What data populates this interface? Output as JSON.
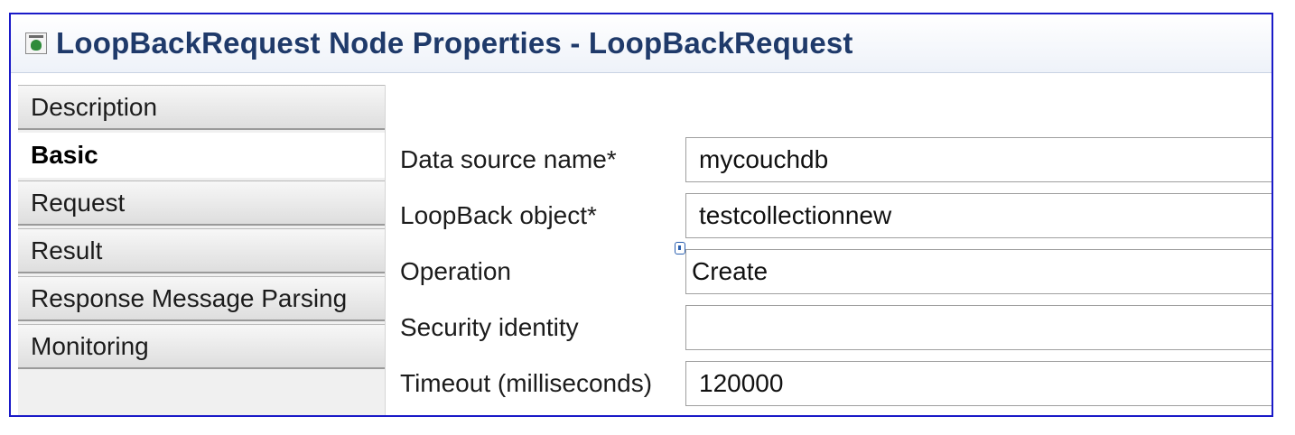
{
  "window": {
    "title": "LoopBackRequest Node Properties - LoopBackRequest",
    "title_icon": "node-properties-icon"
  },
  "sidebar": {
    "tabs": [
      {
        "label": "Description",
        "active": false
      },
      {
        "label": "Basic",
        "active": true
      },
      {
        "label": "Request",
        "active": false
      },
      {
        "label": "Result",
        "active": false
      },
      {
        "label": "Response Message Parsing",
        "active": false
      },
      {
        "label": "Monitoring",
        "active": false
      }
    ]
  },
  "form": {
    "data_source": {
      "label": "Data source name*",
      "value": "mycouchdb"
    },
    "loopback_object": {
      "label": "LoopBack object*",
      "value": "testcollectionnew"
    },
    "operation": {
      "label": "Operation",
      "value": "Create"
    },
    "security_identity": {
      "label": "Security identity",
      "value": ""
    },
    "timeout": {
      "label": "Timeout (milliseconds)",
      "value": "120000"
    }
  },
  "colors": {
    "title_text": "#1f3a6a",
    "frame_border": "#1a1ac8"
  }
}
